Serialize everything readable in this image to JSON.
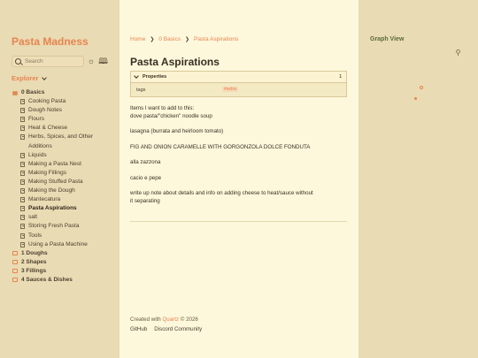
{
  "site": {
    "title": "Pasta Madness"
  },
  "search": {
    "placeholder": "Search"
  },
  "explorer": {
    "title": "Explorer",
    "tree": [
      {
        "type": "folder",
        "label": "0 Basics",
        "open": true
      },
      {
        "type": "file",
        "label": "Cooking Pasta"
      },
      {
        "type": "file",
        "label": "Dough Notes"
      },
      {
        "type": "file",
        "label": "Flours"
      },
      {
        "type": "file",
        "label": "Heat & Cheese"
      },
      {
        "type": "file",
        "label": "Herbs, Spices, and Other Additions"
      },
      {
        "type": "file",
        "label": "Liquids"
      },
      {
        "type": "file",
        "label": "Making a Pasta Nest"
      },
      {
        "type": "file",
        "label": "Making Fillings"
      },
      {
        "type": "file",
        "label": "Making Stuffed Pasta"
      },
      {
        "type": "file",
        "label": "Making the Dough"
      },
      {
        "type": "file",
        "label": "Mantecatura"
      },
      {
        "type": "file",
        "label": "Pasta Aspirations",
        "active": true
      },
      {
        "type": "file",
        "label": "salt"
      },
      {
        "type": "file",
        "label": "Storing Fresh Pasta"
      },
      {
        "type": "file",
        "label": "Tools"
      },
      {
        "type": "file",
        "label": "Using a Pasta Machine"
      },
      {
        "type": "folder",
        "label": "1 Doughs"
      },
      {
        "type": "folder",
        "label": "2 Shapes"
      },
      {
        "type": "folder",
        "label": "3 Fillings"
      },
      {
        "type": "folder",
        "label": "4 Sauces & Dishes"
      }
    ]
  },
  "breadcrumb": [
    "Home",
    "0 Basics",
    "Pasta Aspirations"
  ],
  "page": {
    "title": "Pasta Aspirations",
    "properties": {
      "label": "Properties",
      "count": "1",
      "key": "tags",
      "tag": "#extra"
    },
    "paragraphs": [
      [
        "Items I want to add to this:",
        "dove pasta/\"chicken\" noodle soup"
      ],
      [
        "lasagna (burrata and heirloom tomato)"
      ],
      [
        "FIG AND ONION CARAMELLE WITH GORGONZOLA DOLCE FONDUTA"
      ],
      [
        "alla zazzona"
      ],
      [
        "cacio e pepe"
      ],
      [
        "write up note about details and info on adding cheese to heat/sauce without",
        "it separating"
      ]
    ]
  },
  "footer": {
    "created_prefix": "Created with",
    "created_link": "Quartz",
    "created_suffix": "© 2026",
    "links": [
      "GitHub",
      "Discord Community"
    ]
  },
  "graph": {
    "title": "Graph View"
  },
  "colors": {
    "accent": "#e8844f",
    "graph_title": "#5a6a3a",
    "center_bg": "#fdf8dc",
    "side_bg": "#e9dbb3"
  }
}
